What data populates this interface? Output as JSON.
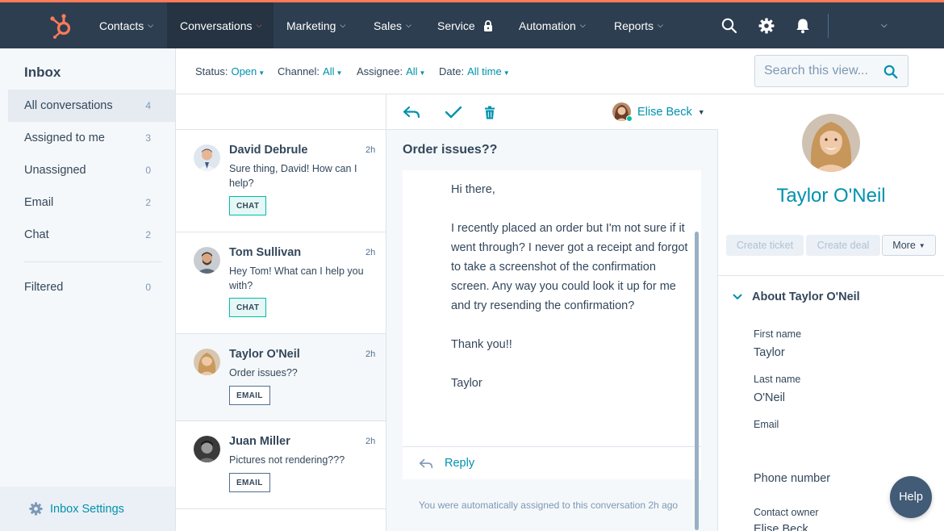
{
  "colors": {
    "nav_bg": "#2d3e50",
    "accent_orange": "#ff7a59",
    "link_teal": "#0091ae",
    "chat_tag": "#00bda5",
    "text": "#33475b"
  },
  "nav": {
    "logo_icon": "hubspot-sprocket-icon",
    "items": [
      {
        "label": "Contacts"
      },
      {
        "label": "Conversations"
      },
      {
        "label": "Marketing"
      },
      {
        "label": "Sales"
      },
      {
        "label": "Service"
      },
      {
        "label": "Automation"
      },
      {
        "label": "Reports"
      }
    ],
    "icons": [
      "search-icon",
      "gear-icon",
      "bell-icon"
    ]
  },
  "sidebar": {
    "title": "Inbox",
    "items": [
      {
        "label": "All conversations",
        "count": "4"
      },
      {
        "label": "Assigned to me",
        "count": "3"
      },
      {
        "label": "Unassigned",
        "count": "0"
      },
      {
        "label": "Email",
        "count": "2"
      },
      {
        "label": "Chat",
        "count": "2"
      },
      {
        "label": "Filtered",
        "count": "0"
      }
    ],
    "settings_label": "Inbox Settings"
  },
  "filters": {
    "status_label": "Status:",
    "status_value": "Open",
    "channel_label": "Channel:",
    "channel_value": "All",
    "assignee_label": "Assignee:",
    "assignee_value": "All",
    "date_label": "Date:",
    "date_value": "All time",
    "search_placeholder": "Search this view..."
  },
  "conversations": [
    {
      "name": "David Debrule",
      "time": "2h",
      "preview": "Sure thing, David! How can I help?",
      "tag": "CHAT"
    },
    {
      "name": "Tom Sullivan",
      "time": "2h",
      "preview": "Hey Tom! What can I help you with?",
      "tag": "CHAT"
    },
    {
      "name": "Taylor O'Neil",
      "time": "2h",
      "preview": "Order issues??",
      "tag": "EMAIL"
    },
    {
      "name": "Juan Miller",
      "time": "2h",
      "preview": "Pictures not rendering???",
      "tag": "EMAIL"
    }
  ],
  "thread": {
    "owner": "Elise Beck",
    "subject": "Order issues??",
    "body": [
      "Hi there,",
      "I recently placed an order but I'm not sure if it went through? I never got a receipt and forgot to take a screenshot of the confirmation screen. Any way you could look it up for me and try resending the confirmation?",
      "Thank you!!",
      "Taylor"
    ],
    "reply_label": "Reply",
    "auto_note": "You were automatically assigned to this conversation 2h ago"
  },
  "contact": {
    "name": "Taylor O'Neil",
    "buttons": {
      "create_ticket": "Create ticket",
      "create_deal": "Create deal",
      "more": "More"
    },
    "about_title": "About Taylor O'Neil",
    "first_name_label": "First name",
    "first_name": "Taylor",
    "last_name_label": "Last name",
    "last_name": "O'Neil",
    "email_label": "Email",
    "phone_label": "Phone number",
    "owner_label": "Contact owner",
    "owner_value": "Elise Beck"
  },
  "help_label": "Help"
}
